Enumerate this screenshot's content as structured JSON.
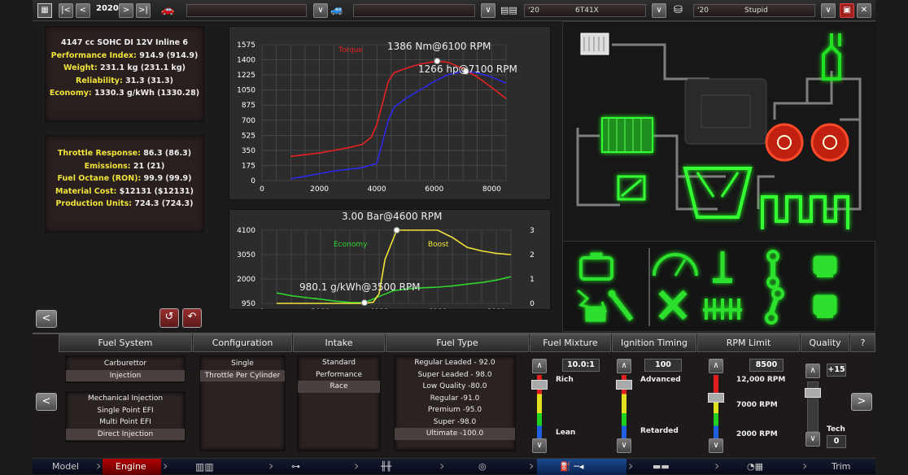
{
  "topbar": {
    "year": "2020",
    "field_a": "",
    "field_b": "",
    "engine_year": "'20",
    "engine_name": "6T41X",
    "trim_year": "'20",
    "trim_name": "Stupid"
  },
  "stats_main": [
    {
      "label": "4147 cc SOHC DI 12V Inline 6",
      "value": ""
    },
    {
      "label": "Performance Index:",
      "value": "914.9 (914.9)"
    },
    {
      "label": "Weight:",
      "value": "231.1 kg (231.1 kg)"
    },
    {
      "label": "Reliability:",
      "value": "31.3 (31.3)"
    },
    {
      "label": "Economy:",
      "value": "1330.3 g/kWh (1330.28)"
    }
  ],
  "stats_secondary": [
    {
      "label": "Throttle Response:",
      "value": "86.3 (86.3)"
    },
    {
      "label": "Emissions:",
      "value": "21 (21)"
    },
    {
      "label": "Fuel Octane (RON):",
      "value": "99.9 (99.9)"
    },
    {
      "label": "Material Cost:",
      "value": "$12131 ($12131)"
    },
    {
      "label": "Production Units:",
      "value": "724.3 (724.3)"
    }
  ],
  "chart_data": [
    {
      "type": "line",
      "series": [
        {
          "name": "Torque",
          "color": "#e82020",
          "x": [
            1000,
            1500,
            2000,
            2500,
            3000,
            3500,
            3800,
            4000,
            4200,
            4400,
            4600,
            5000,
            5500,
            6000,
            6100,
            6500,
            7000,
            7500,
            8000,
            8500
          ],
          "y": [
            280,
            300,
            320,
            350,
            380,
            420,
            500,
            650,
            900,
            1150,
            1250,
            1300,
            1350,
            1380,
            1386,
            1370,
            1300,
            1200,
            1080,
            950
          ]
        },
        {
          "name": "",
          "color": "#2a2ae8",
          "x": [
            1000,
            1500,
            2000,
            2500,
            3000,
            3500,
            4000,
            4200,
            4400,
            4600,
            5000,
            5500,
            6000,
            6500,
            7000,
            7100,
            7500,
            8000,
            8500
          ],
          "y": [
            20,
            50,
            80,
            110,
            130,
            150,
            200,
            450,
            700,
            850,
            950,
            1050,
            1150,
            1230,
            1264,
            1266,
            1250,
            1200,
            1130
          ]
        }
      ],
      "ylim": [
        0,
        1575
      ],
      "yticks": [
        0,
        175,
        350,
        525,
        700,
        875,
        1050,
        1225,
        1400,
        1575
      ],
      "xlim": [
        0,
        8500
      ],
      "xticks": [
        0,
        2000,
        4000,
        6000,
        8000
      ],
      "annotations": [
        "1386 Nm@6100 RPM",
        "1266 hp@7100 RPM"
      ],
      "markers": [
        {
          "x": 6100,
          "y": 1386
        },
        {
          "x": 7100,
          "y": 1266
        }
      ]
    },
    {
      "type": "line",
      "series": [
        {
          "name": "Economy",
          "color": "#2fd62f",
          "x": [
            500,
            1000,
            1500,
            2000,
            2500,
            3000,
            3500,
            4000,
            4500,
            5000,
            5500,
            6000,
            6500,
            7000,
            7500,
            8000,
            8500
          ],
          "y": [
            1400,
            1280,
            1200,
            1130,
            1050,
            990,
            980,
            1250,
            1500,
            1580,
            1620,
            1650,
            1700,
            1780,
            1850,
            1950,
            2100
          ]
        },
        {
          "name": "Boost",
          "color": "#f0e43a",
          "x": [
            500,
            1000,
            2000,
            3000,
            3500,
            3800,
            4000,
            4200,
            4600,
            5000,
            5500,
            6000,
            6500,
            7000,
            7500,
            8000,
            8500
          ],
          "y": [
            0,
            0,
            0,
            0,
            0,
            0.05,
            0.4,
            1.8,
            3.0,
            3.0,
            3.0,
            3.0,
            2.7,
            2.3,
            2.15,
            2.05,
            2.0
          ]
        }
      ],
      "ylim": [
        950,
        4100
      ],
      "yticks": [
        950,
        2000,
        3050,
        4100
      ],
      "y2lim": [
        0,
        3
      ],
      "y2ticks": [
        0,
        1,
        2,
        3
      ],
      "xlim": [
        0,
        8500
      ],
      "xticks": [
        0,
        2000,
        4000,
        6000,
        8000
      ],
      "annotations": [
        "3.00 Bar@4600 RPM",
        "980.1 g/kWh@3500 RPM"
      ],
      "markers": [
        {
          "x": 4600,
          "y2": 3.0
        },
        {
          "x": 3500,
          "y": 980
        }
      ]
    }
  ],
  "bottom": {
    "fuel_system": {
      "title": "Fuel System",
      "types": [
        "Carburettor",
        "Injection"
      ],
      "subtypes": [
        "Mechanical Injection",
        "Single Point EFI",
        "Multi Point EFI",
        "Direct Injection"
      ]
    },
    "configuration": {
      "title": "Configuration",
      "items": [
        "Single",
        "Throttle Per Cylinder"
      ]
    },
    "intake": {
      "title": "Intake",
      "items": [
        "Standard",
        "Performance",
        "Race"
      ]
    },
    "fuel_type": {
      "title": "Fuel Type",
      "items": [
        "Regular Leaded - 92.0",
        "Super Leaded - 98.0",
        "Low Quality -80.0",
        "Regular -91.0",
        "Premium -95.0",
        "Super -98.0",
        "Ultimate -100.0"
      ]
    },
    "fuel_mixture": {
      "title": "Fuel Mixture",
      "value": "10.0:1",
      "top": "Rich",
      "bottom": "Lean"
    },
    "ignition": {
      "title": "Ignition Timing",
      "value": "100",
      "top": "Advanced",
      "bottom": "Retarded"
    },
    "rpm": {
      "title": "RPM Limit",
      "value": "8500",
      "l1": "12,000 RPM",
      "l2": "7000 RPM",
      "l3": "2000 RPM"
    },
    "quality": {
      "title": "Quality",
      "value": "+15",
      "label": "Tech",
      "tech": "0",
      "help": "?"
    }
  },
  "nav": {
    "model": "Model",
    "engine": "Engine",
    "trim": "Trim"
  }
}
